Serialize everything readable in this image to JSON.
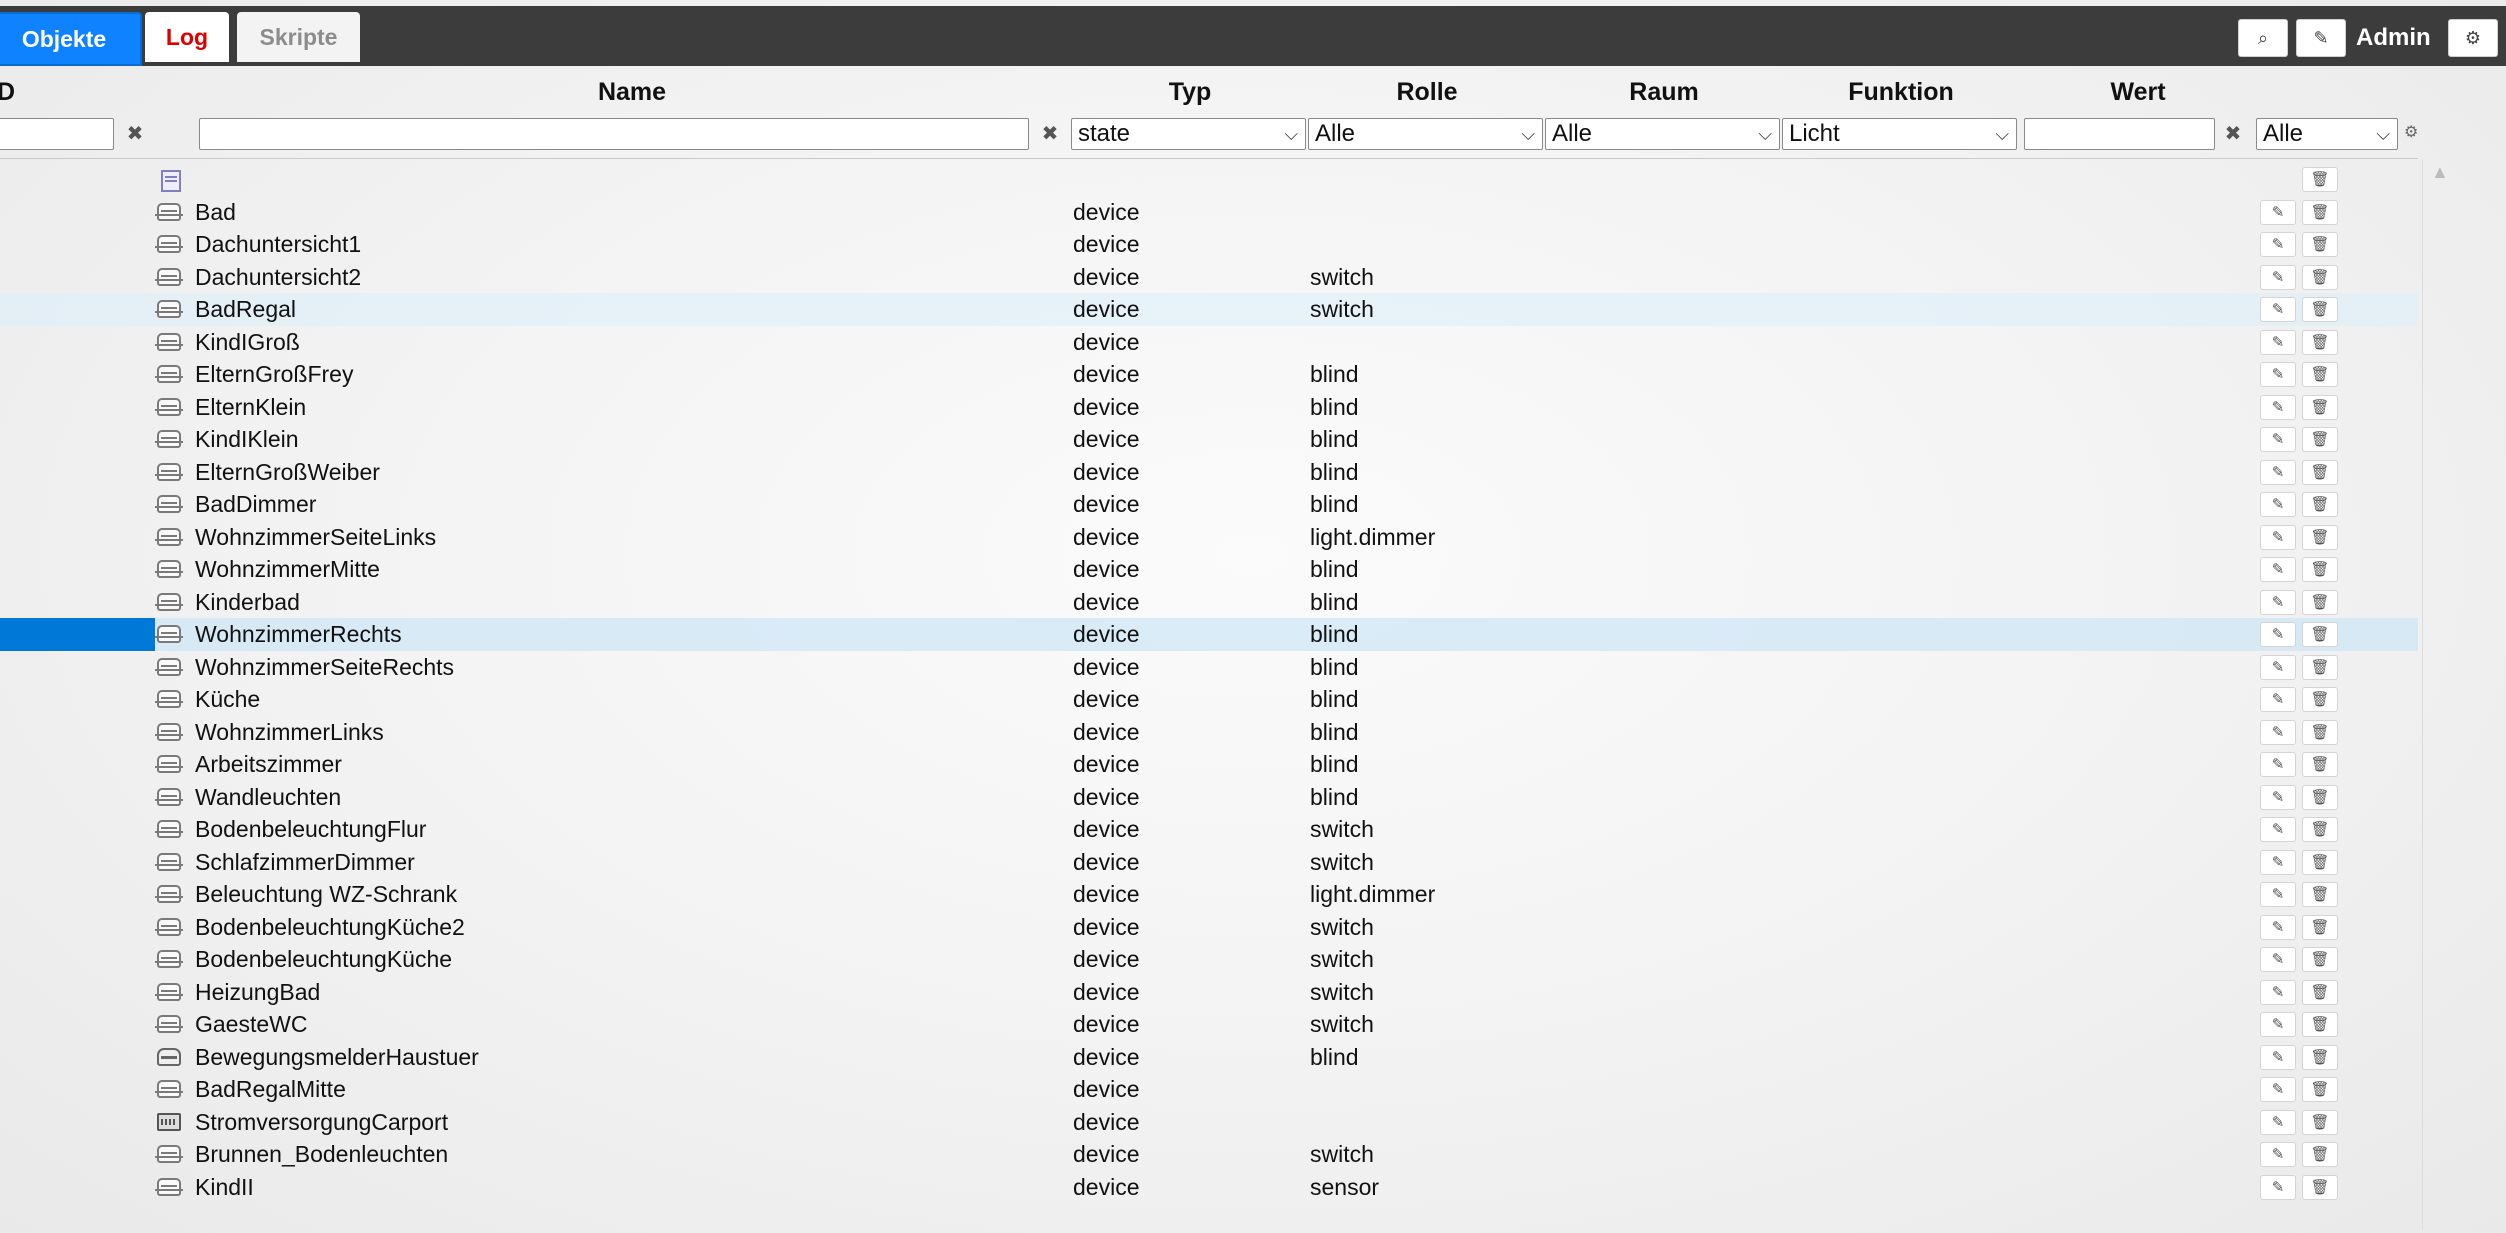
{
  "tabs": {
    "objekte": "Objekte",
    "log": "Log",
    "skripte": "Skripte"
  },
  "header": {
    "user": "Admin"
  },
  "columns": {
    "id": "D",
    "name": "Name",
    "typ": "Typ",
    "rolle": "Rolle",
    "raum": "Raum",
    "funktion": "Funktion",
    "wert": "Wert"
  },
  "filters": {
    "id_value": "",
    "name_value": "",
    "typ_selected": "state",
    "rolle_selected": "Alle",
    "raum_selected": "Alle",
    "funktion_selected": "Licht",
    "wert_value": "",
    "extra_selected": "Alle"
  },
  "rows": [
    {
      "name": "",
      "typ": "",
      "rolle": "",
      "icon": "document-icon"
    },
    {
      "name": "Bad",
      "typ": "device",
      "rolle": "",
      "icon": "device-icon"
    },
    {
      "name": "Dachuntersicht1",
      "typ": "device",
      "rolle": "",
      "icon": "device-icon"
    },
    {
      "name": "Dachuntersicht2",
      "typ": "device",
      "rolle": "switch",
      "icon": "device-icon"
    },
    {
      "name": "BadRegal",
      "typ": "device",
      "rolle": "switch",
      "icon": "device-icon"
    },
    {
      "name": "KindIGroß",
      "typ": "device",
      "rolle": "",
      "icon": "device-icon"
    },
    {
      "name": "ElternGroßFrey",
      "typ": "device",
      "rolle": "blind",
      "icon": "device-icon"
    },
    {
      "name": "ElternKlein",
      "typ": "device",
      "rolle": "blind",
      "icon": "device-icon"
    },
    {
      "name": "KindIKlein",
      "typ": "device",
      "rolle": "blind",
      "icon": "device-icon"
    },
    {
      "name": "ElternGroßWeiber",
      "typ": "device",
      "rolle": "blind",
      "icon": "device-icon"
    },
    {
      "name": "BadDimmer",
      "typ": "device",
      "rolle": "blind",
      "icon": "device-icon"
    },
    {
      "name": "WohnzimmerSeiteLinks",
      "typ": "device",
      "rolle": "light.dimmer",
      "icon": "device-icon"
    },
    {
      "name": "WohnzimmerMitte",
      "typ": "device",
      "rolle": "blind",
      "icon": "device-icon"
    },
    {
      "name": "Kinderbad",
      "typ": "device",
      "rolle": "blind",
      "icon": "device-icon"
    },
    {
      "name": "WohnzimmerRechts",
      "typ": "device",
      "rolle": "blind",
      "icon": "device-icon"
    },
    {
      "name": "WohnzimmerSeiteRechts",
      "typ": "device",
      "rolle": "blind",
      "icon": "device-icon"
    },
    {
      "name": "Küche",
      "typ": "device",
      "rolle": "blind",
      "icon": "device-icon"
    },
    {
      "name": "WohnzimmerLinks",
      "typ": "device",
      "rolle": "blind",
      "icon": "device-icon"
    },
    {
      "name": "Arbeitszimmer",
      "typ": "device",
      "rolle": "blind",
      "icon": "device-icon"
    },
    {
      "name": "Wandleuchten",
      "typ": "device",
      "rolle": "blind",
      "icon": "device-icon"
    },
    {
      "name": "BodenbeleuchtungFlur",
      "typ": "device",
      "rolle": "switch",
      "icon": "device-icon"
    },
    {
      "name": "SchlafzimmerDimmer",
      "typ": "device",
      "rolle": "switch",
      "icon": "device-icon"
    },
    {
      "name": "Beleuchtung WZ-Schrank",
      "typ": "device",
      "rolle": "light.dimmer",
      "icon": "device-icon"
    },
    {
      "name": "BodenbeleuchtungKüche2",
      "typ": "device",
      "rolle": "switch",
      "icon": "device-icon"
    },
    {
      "name": "BodenbeleuchtungKüche",
      "typ": "device",
      "rolle": "switch",
      "icon": "device-icon"
    },
    {
      "name": "HeizungBad",
      "typ": "device",
      "rolle": "switch",
      "icon": "device-icon"
    },
    {
      "name": "GaesteWC",
      "typ": "device",
      "rolle": "switch",
      "icon": "device-icon"
    },
    {
      "name": "BewegungsmelderHaustuer",
      "typ": "device",
      "rolle": "blind",
      "icon": "motion-sensor-icon"
    },
    {
      "name": "BadRegalMitte",
      "typ": "device",
      "rolle": "",
      "icon": "device-icon"
    },
    {
      "name": "StromversorgungCarport",
      "typ": "device",
      "rolle": "",
      "icon": "power-supply-icon"
    },
    {
      "name": "Brunnen_Bodenleuchten",
      "typ": "device",
      "rolle": "switch",
      "icon": "device-icon"
    },
    {
      "name": "KindII",
      "typ": "device",
      "rolle": "sensor",
      "icon": "device-icon"
    }
  ]
}
